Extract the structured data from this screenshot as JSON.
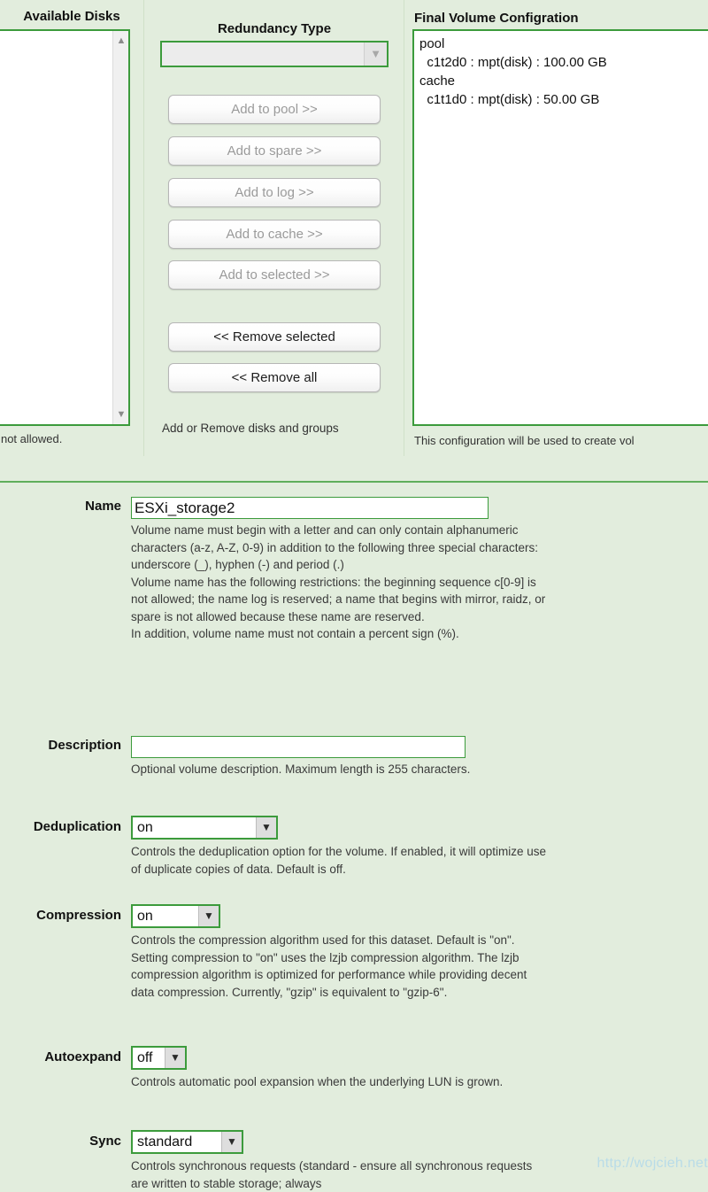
{
  "colors": {
    "background": "#e2eddd",
    "border_green": "#3c9b3c",
    "divider_green": "#5fae5b",
    "watermark": "#b9dce8"
  },
  "top_panel": {
    "available_disks": {
      "title": "Available Disks",
      "items": [],
      "hint": "ons are not allowed.",
      "scroll_up_icon": "chevron-up-icon",
      "scroll_down_icon": "chevron-down-icon"
    },
    "redundancy": {
      "title": "Redundancy Type",
      "selected": "",
      "dropdown_icon": "chevron-down-icon",
      "buttons": [
        {
          "label": "Add to pool >>",
          "enabled": false
        },
        {
          "label": "Add to spare >>",
          "enabled": false
        },
        {
          "label": "Add to log >>",
          "enabled": false
        },
        {
          "label": "Add to cache >>",
          "enabled": false
        },
        {
          "label": "Add to selected >>",
          "enabled": false
        },
        {
          "label": "<< Remove selected",
          "enabled": true
        },
        {
          "label": "<< Remove all",
          "enabled": true
        }
      ],
      "hint": "Add or Remove disks and groups"
    },
    "final_config": {
      "title": "Final Volume Configration",
      "lines": [
        "pool",
        "  c1t2d0 : mpt(disk) : 100.00 GB",
        "cache",
        "  c1t1d0 : mpt(disk) : 50.00 GB"
      ],
      "hint": "This configuration will be used to create vol"
    }
  },
  "form": {
    "name": {
      "label": "Name",
      "value": "ESXi_storage2",
      "placeholder": "",
      "help": "Volume name must begin with a letter and can only contain alphanumeric characters (a-z, A-Z, 0-9) in addition to the following three special characters: underscore (_), hyphen (-) and period (.)\nVolume name has the following restrictions: the beginning sequence c[0-9] is not allowed; the name log is reserved; a name that begins with mirror, raidz, or spare is not allowed because these name are reserved.\nIn addition, volume name must not contain a percent sign (%)."
    },
    "description": {
      "label": "Description",
      "value": "",
      "placeholder": "",
      "help": "Optional volume description. Maximum length is 255 characters."
    },
    "deduplication": {
      "label": "Deduplication",
      "value": "on",
      "dropdown_icon": "chevron-down-icon",
      "help": "Controls the deduplication option for the volume. If enabled, it will optimize use of duplicate copies of data. Default is off."
    },
    "compression": {
      "label": "Compression",
      "value": "on",
      "dropdown_icon": "chevron-down-icon",
      "help": "Controls the compression algorithm used for this dataset. Default is \"on\". Setting compression to \"on\" uses the lzjb compression algorithm. The lzjb compression algorithm is optimized for performance while providing decent data compression. Currently, \"gzip\" is equivalent to \"gzip-6\"."
    },
    "autoexpand": {
      "label": "Autoexpand",
      "value": "off",
      "dropdown_icon": "chevron-down-icon",
      "help": "Controls automatic pool expansion when the underlying LUN is grown."
    },
    "sync": {
      "label": "Sync",
      "value": "standard",
      "dropdown_icon": "chevron-down-icon",
      "help": "Controls synchronous requests (standard - ensure all synchronous requests are written to stable storage; always"
    }
  },
  "watermark": "http://wojcieh.net"
}
